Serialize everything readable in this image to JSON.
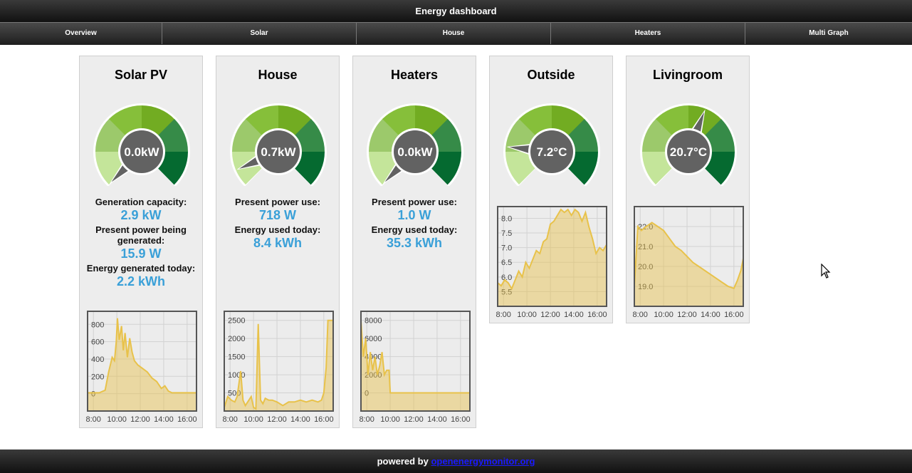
{
  "header": {
    "title": "Energy dashboard"
  },
  "nav": {
    "items": [
      {
        "label": "Overview"
      },
      {
        "label": "Solar"
      },
      {
        "label": "House"
      },
      {
        "label": "Heaters"
      },
      {
        "label": "Multi Graph"
      }
    ]
  },
  "panels": [
    {
      "title": "Solar PV",
      "gauge": {
        "value_text": "0.0kW",
        "level": 0.0
      },
      "stats": [
        {
          "label": "Generation capacity:",
          "value": "2.9 kW"
        },
        {
          "label": "Present power being generated:",
          "value": "15.9 W"
        },
        {
          "label": "Energy generated today:",
          "value": "2.2 kWh"
        }
      ],
      "chart_data": {
        "type": "area",
        "x_ticks": [
          "8:00",
          "10:00",
          "12:00",
          "14:00",
          "16:00"
        ],
        "y_ticks": [
          "800",
          "600",
          "400",
          "200",
          "0"
        ],
        "ylim": [
          -200,
          950
        ],
        "xlim": [
          7.5,
          16.8
        ],
        "x": [
          7.5,
          8.5,
          9.0,
          9.3,
          9.6,
          9.8,
          9.95,
          10.05,
          10.2,
          10.4,
          10.55,
          10.7,
          10.9,
          11.1,
          11.3,
          11.5,
          11.8,
          12.2,
          12.6,
          13.0,
          13.4,
          13.8,
          14.1,
          14.4,
          14.7,
          15.0,
          15.5,
          16.0,
          16.8
        ],
        "y": [
          10,
          10,
          40,
          250,
          420,
          380,
          600,
          870,
          620,
          780,
          500,
          700,
          420,
          640,
          480,
          380,
          330,
          290,
          250,
          180,
          140,
          60,
          90,
          30,
          10,
          10,
          10,
          10,
          10
        ],
        "color": "#e8c24a"
      }
    },
    {
      "title": "House",
      "gauge": {
        "value_text": "0.7kW",
        "level": 0.08
      },
      "stats": [
        {
          "label": "Present power use:",
          "value": "718 W"
        },
        {
          "label": "Energy used today:",
          "value": "8.4 kWh"
        }
      ],
      "chart_data": {
        "type": "area",
        "x_ticks": [
          "8:00",
          "10:00",
          "12:00",
          "14:00",
          "16:00"
        ],
        "y_ticks": [
          "2500",
          "2000",
          "1500",
          "1000",
          "500"
        ],
        "ylim": [
          0,
          2750
        ],
        "xlim": [
          7.5,
          16.8
        ],
        "x": [
          7.5,
          7.8,
          8.1,
          8.4,
          8.6,
          8.9,
          9.1,
          9.3,
          9.5,
          9.8,
          10.0,
          10.2,
          10.4,
          10.6,
          10.8,
          11.0,
          11.3,
          11.6,
          12.0,
          12.5,
          13.0,
          13.5,
          14.0,
          14.5,
          15.0,
          15.5,
          15.8,
          16.0,
          16.2,
          16.35,
          16.5,
          16.8
        ],
        "y": [
          100,
          400,
          300,
          250,
          400,
          1100,
          300,
          150,
          250,
          400,
          100,
          60,
          2400,
          300,
          200,
          350,
          300,
          300,
          250,
          150,
          250,
          250,
          300,
          250,
          300,
          250,
          300,
          500,
          1200,
          2500,
          2500,
          2500
        ],
        "color": "#e8c24a"
      }
    },
    {
      "title": "Heaters",
      "gauge": {
        "value_text": "0.0kW",
        "level": 0.0
      },
      "stats": [
        {
          "label": "Present power use:",
          "value": "1.0 W"
        },
        {
          "label": "Energy used today:",
          "value": "35.3 kWh"
        }
      ],
      "chart_data": {
        "type": "area",
        "x_ticks": [
          "8:00",
          "10:00",
          "12:00",
          "14:00",
          "16:00"
        ],
        "y_ticks": [
          "8000",
          "6000",
          "4000",
          "2000",
          "0"
        ],
        "ylim": [
          -2000,
          9000
        ],
        "xlim": [
          7.5,
          16.8
        ],
        "x": [
          7.5,
          7.7,
          7.9,
          8.1,
          8.3,
          8.5,
          8.7,
          8.9,
          9.1,
          9.3,
          9.5,
          9.7,
          9.9,
          10.0,
          10.2,
          10.5,
          11.0,
          12.0,
          13.0,
          14.0,
          15.0,
          16.0,
          16.8
        ],
        "y": [
          8000,
          4000,
          6000,
          2000,
          4500,
          2500,
          4000,
          2000,
          3000,
          4500,
          2000,
          2500,
          2500,
          0,
          0,
          0,
          0,
          0,
          0,
          0,
          0,
          0,
          0
        ],
        "color": "#e8c24a"
      }
    },
    {
      "title": "Outside",
      "gauge": {
        "value_text": "7.2°C",
        "level": 0.19
      },
      "stats": [],
      "chart_data": {
        "type": "area",
        "x_ticks": [
          "8:00",
          "10:00",
          "12:00",
          "14:00",
          "16:00"
        ],
        "y_ticks": [
          "8.0",
          "7.5",
          "7.0",
          "6.5",
          "6.0",
          "5.5"
        ],
        "ylim": [
          5.0,
          8.4
        ],
        "xlim": [
          7.5,
          16.8
        ],
        "x": [
          7.5,
          7.8,
          8.1,
          8.4,
          8.7,
          9.0,
          9.3,
          9.6,
          9.9,
          10.2,
          10.5,
          10.8,
          11.1,
          11.4,
          11.7,
          12.0,
          12.3,
          12.6,
          12.9,
          13.2,
          13.5,
          13.8,
          14.1,
          14.4,
          14.7,
          15.0,
          15.3,
          15.6,
          15.9,
          16.2,
          16.5,
          16.8
        ],
        "y": [
          5.8,
          5.7,
          5.9,
          5.8,
          5.6,
          5.9,
          6.2,
          6.0,
          6.5,
          6.3,
          6.6,
          6.9,
          6.8,
          7.2,
          7.3,
          7.8,
          7.9,
          8.1,
          8.3,
          8.2,
          8.3,
          8.1,
          8.3,
          8.2,
          7.9,
          8.2,
          7.7,
          7.3,
          6.8,
          7.0,
          6.9,
          7.1
        ],
        "color": "#e8c24a"
      }
    },
    {
      "title": "Livingroom",
      "gauge": {
        "value_text": "20.7°C",
        "level": 0.58
      },
      "stats": [],
      "chart_data": {
        "type": "area",
        "x_ticks": [
          "8:00",
          "10:00",
          "12:00",
          "14:00",
          "16:00"
        ],
        "y_ticks": [
          "22.0",
          "21.0",
          "20.0",
          "19.0"
        ],
        "ylim": [
          18.0,
          23.0
        ],
        "xlim": [
          7.5,
          16.8
        ],
        "x": [
          7.5,
          7.8,
          8.1,
          8.5,
          9.0,
          9.5,
          10.0,
          10.5,
          11.0,
          11.5,
          12.0,
          12.5,
          13.0,
          13.5,
          14.0,
          14.5,
          15.0,
          15.5,
          16.0,
          16.3,
          16.6,
          16.8
        ],
        "y": [
          19.0,
          22.0,
          21.8,
          22.0,
          22.2,
          22.0,
          21.8,
          21.4,
          21.0,
          20.8,
          20.5,
          20.2,
          20.0,
          19.8,
          19.6,
          19.4,
          19.2,
          19.0,
          18.9,
          19.3,
          19.8,
          20.4
        ],
        "color": "#e8c24a"
      }
    }
  ],
  "footer": {
    "prefix": "powered by",
    "link_text": "openenergymonitor.org"
  },
  "icons": {
    "cursor": "mouse-pointer-icon"
  }
}
